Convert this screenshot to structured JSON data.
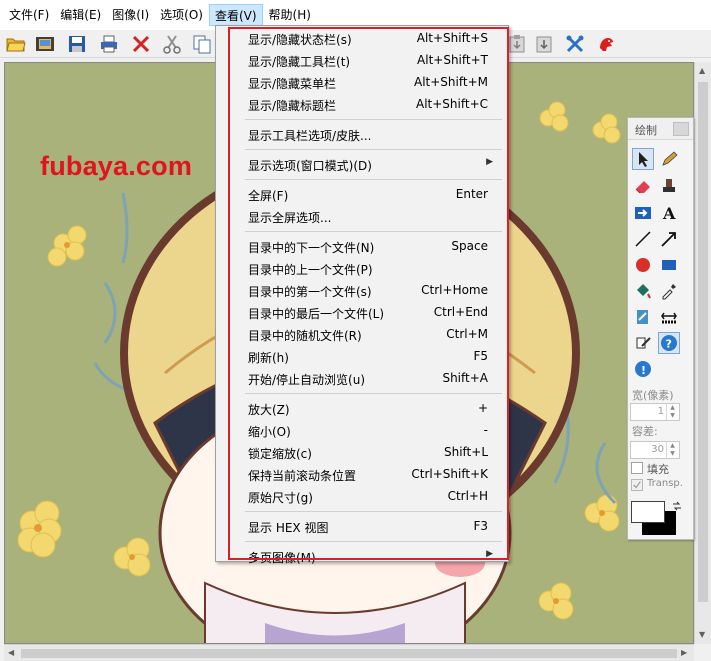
{
  "menubar": {
    "items": [
      {
        "label": "文件(F)",
        "active": false
      },
      {
        "label": "编辑(E)",
        "active": false
      },
      {
        "label": "图像(I)",
        "active": false
      },
      {
        "label": "选项(O)",
        "active": false
      },
      {
        "label": "查看(V)",
        "active": true
      },
      {
        "label": "帮助(H)",
        "active": false
      }
    ]
  },
  "toolbar": {
    "icons": [
      "open-folder-icon",
      "filmstrip-icon",
      "save-icon",
      "print-icon",
      "delete-icon",
      "cut-icon",
      "copy-icon",
      "paste-icon",
      "settings-icon",
      "about-icon"
    ]
  },
  "canvas": {
    "watermark": "fubaya.com",
    "background_color": "#a8b27a"
  },
  "view_menu": {
    "groups": [
      [
        {
          "label": "显示/隐藏状态栏(s)",
          "shortcut": "Alt+Shift+S",
          "submenu": false
        },
        {
          "label": "显示/隐藏工具栏(t)",
          "shortcut": "Alt+Shift+T",
          "submenu": false
        },
        {
          "label": "显示/隐藏菜单栏",
          "shortcut": "Alt+Shift+M",
          "submenu": false
        },
        {
          "label": "显示/隐藏标题栏",
          "shortcut": "Alt+Shift+C",
          "submenu": false
        }
      ],
      [
        {
          "label": "显示工具栏选项/皮肤...",
          "shortcut": "",
          "submenu": false
        }
      ],
      [
        {
          "label": "显示选项(窗口模式)(D)",
          "shortcut": "",
          "submenu": true
        }
      ],
      [
        {
          "label": "全屏(F)",
          "shortcut": "Enter",
          "submenu": false
        },
        {
          "label": "显示全屏选项...",
          "shortcut": "",
          "submenu": false
        }
      ],
      [
        {
          "label": "目录中的下一个文件(N)",
          "shortcut": "Space",
          "submenu": false
        },
        {
          "label": "目录中的上一个文件(P)",
          "shortcut": "",
          "submenu": false
        },
        {
          "label": "目录中的第一个文件(s)",
          "shortcut": "Ctrl+Home",
          "submenu": false
        },
        {
          "label": "目录中的最后一个文件(L)",
          "shortcut": "Ctrl+End",
          "submenu": false
        },
        {
          "label": "目录中的随机文件(R)",
          "shortcut": "Ctrl+M",
          "submenu": false
        },
        {
          "label": "刷新(h)",
          "shortcut": "F5",
          "submenu": false
        },
        {
          "label": "开始/停止自动浏览(u)",
          "shortcut": "Shift+A",
          "submenu": false
        }
      ],
      [
        {
          "label": "放大(Z)",
          "shortcut": "+",
          "submenu": false
        },
        {
          "label": "缩小(O)",
          "shortcut": "-",
          "submenu": false
        },
        {
          "label": "锁定缩放(c)",
          "shortcut": "Shift+L",
          "submenu": false
        },
        {
          "label": "保持当前滚动条位置",
          "shortcut": "Ctrl+Shift+K",
          "submenu": false
        },
        {
          "label": "原始尺寸(g)",
          "shortcut": "Ctrl+H",
          "submenu": false
        }
      ],
      [
        {
          "label": "显示 HEX 视图",
          "shortcut": "F3",
          "submenu": false
        }
      ],
      [
        {
          "label": "多页图像(M)",
          "shortcut": "",
          "submenu": true
        }
      ]
    ]
  },
  "palette": {
    "title": "绘制",
    "width_label": "宽(像素)",
    "width_value": "1",
    "tolerance_label": "容差:",
    "tolerance_value": "30",
    "fill_label": "填充",
    "fill_checked": false,
    "transparent_label": "Transp.",
    "transparent_checked": true,
    "foreground_color": "#ffffff",
    "background_color": "#000000"
  }
}
